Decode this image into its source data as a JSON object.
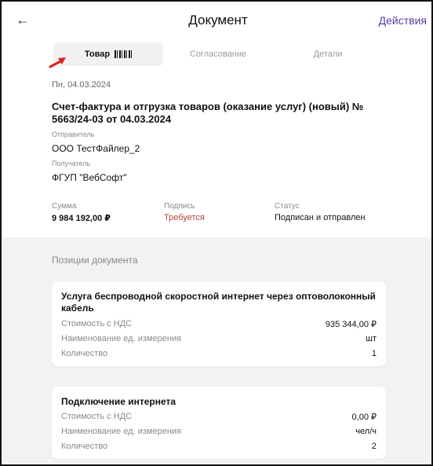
{
  "header": {
    "back_icon": "←",
    "title": "Документ",
    "actions_label": "Действия"
  },
  "tabs": [
    {
      "label": "Товар",
      "active": true
    },
    {
      "label": "Согласование",
      "active": false
    },
    {
      "label": "Детали",
      "active": false
    }
  ],
  "document": {
    "date": "Пн, 04.03.2024",
    "title": "Счет-фактура и отгрузка товаров (оказание услуг) (новый) № 5663/24-03 от 04.03.2024",
    "sender_label": "Отправитель",
    "sender": "ООО ТестФайлер_2",
    "recipient_label": "Получатель",
    "recipient": "ФГУП \"ВебСофт\"",
    "sum_label": "Сумма",
    "sum": "9 984 192,00 ₽",
    "signature_label": "Подпись",
    "signature": "Требуется",
    "status_label": "Статус",
    "status": "Подписан и отправлен"
  },
  "positions": {
    "heading": "Позиции документа",
    "items": [
      {
        "title": "Услуга  беспроводной скоростной интернет через оптоволоконный кабель",
        "price_label": "Стоимость с НДС",
        "price": "935 344,00 ₽",
        "unit_label": "Наименование ед. измерения",
        "unit": "шт",
        "qty_label": "Количество",
        "qty": "1"
      },
      {
        "title": "Подключение интернета",
        "price_label": "Стоимость с НДС",
        "price": "0,00 ₽",
        "unit_label": "Наименование ед. измерения",
        "unit": "чел/ч",
        "qty_label": "Количество",
        "qty": "2"
      }
    ]
  },
  "colors": {
    "accent": "#5a3aa6",
    "warning": "#b3403a",
    "pointer_arrow": "#e02020"
  }
}
